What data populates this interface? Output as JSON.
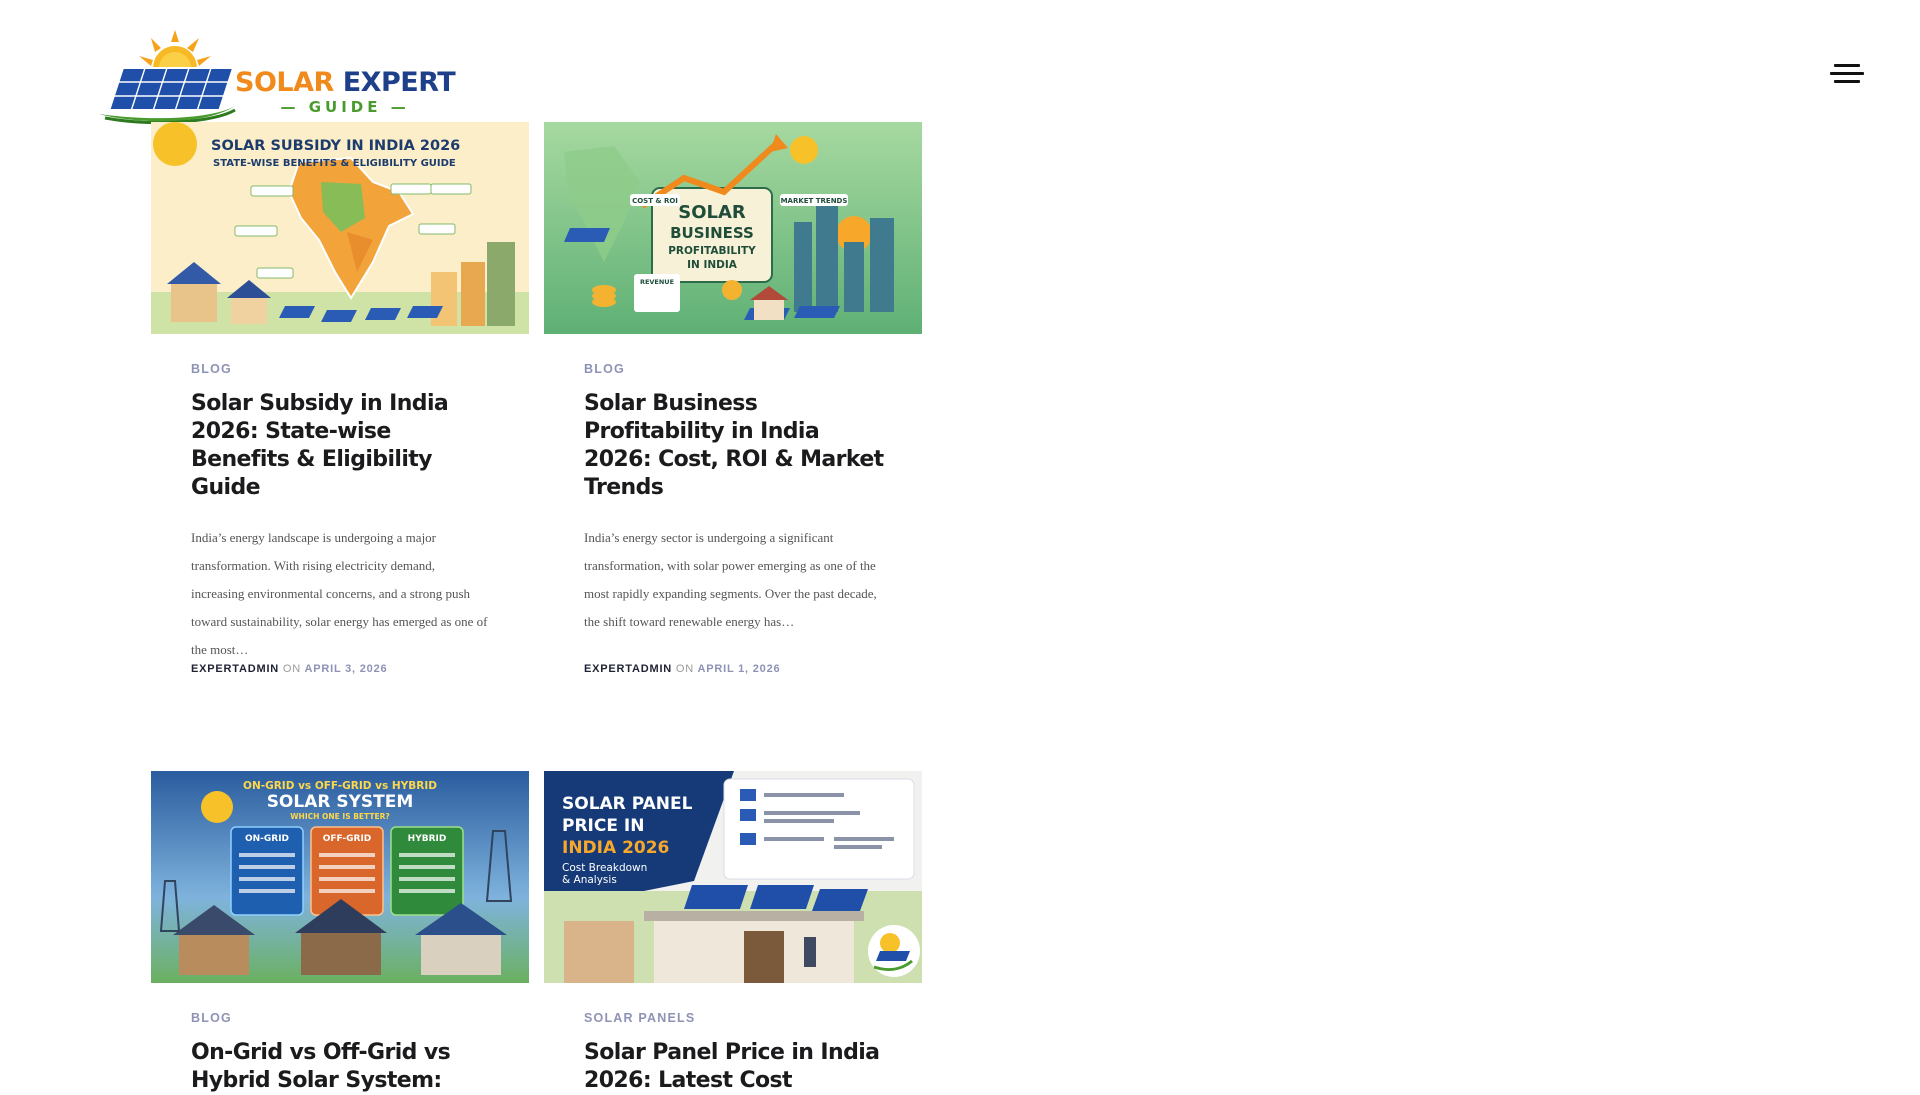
{
  "site": {
    "logo_line1_a": "SOLAR",
    "logo_line1_b": "EXPERT",
    "logo_line2": "GUIDE"
  },
  "posts": [
    {
      "category": "BLOG",
      "title": "Solar Subsidy in India 2026: State-wise Benefits & Eligibility Guide",
      "excerpt": "India’s energy landscape is undergoing a major transformation. With rising electricity demand, increasing environmental concerns, and a strong push toward sustainability, solar energy has emerged as one of the most…",
      "author": "EXPERTADMIN",
      "on": "ON",
      "date": "APRIL 3, 2026",
      "image_title": "SOLAR SUBSIDY IN INDIA 2026",
      "image_subtitle": "STATE-WISE BENEFITS & ELIGIBILITY GUIDE"
    },
    {
      "category": "BLOG",
      "title": "Solar Business Profitability in India 2026: Cost, ROI & Market Trends",
      "excerpt": "India’s energy sector is undergoing a significant transformation, with solar power emerging as one of the most rapidly expanding segments. Over the past decade, the shift toward renewable energy has…",
      "author": "EXPERTADMIN",
      "on": "ON",
      "date": "APRIL 1, 2026",
      "image_line1": "SOLAR",
      "image_line2": "BUSINESS",
      "image_line3": "PROFITABILITY",
      "image_line4": "IN INDIA",
      "image_tag1": "COST & ROI",
      "image_tag2": "MARKET TRENDS",
      "image_tag3": "REVENUE"
    },
    {
      "category": "BLOG",
      "title": "On-Grid vs Off-Grid vs Hybrid Solar System:",
      "image_title1": "ON-GRID vs OFF-GRID vs HYBRID",
      "image_title2": "SOLAR SYSTEM",
      "image_title3": "WHICH ONE IS BETTER?",
      "image_panel1": "ON-GRID",
      "image_panel2": "OFF-GRID",
      "image_panel3": "HYBRID"
    },
    {
      "category": "SOLAR PANELS",
      "title": "Solar Panel Price in India 2026: Latest Cost",
      "image_line1": "SOLAR PANEL",
      "image_line2": "PRICE IN",
      "image_line3": "INDIA 2026",
      "image_line4": "Cost Breakdown",
      "image_line5": "& Analysis"
    }
  ],
  "colors": {
    "accent_category": "#8e93b6",
    "title": "#1b1b1d",
    "logo_orange": "#f08a1c",
    "logo_blue": "#1e3f8a",
    "logo_green": "#4a9b2d"
  },
  "icons": [
    "sun-icon",
    "solar-panel-icon",
    "hamburger-menu-icon"
  ]
}
